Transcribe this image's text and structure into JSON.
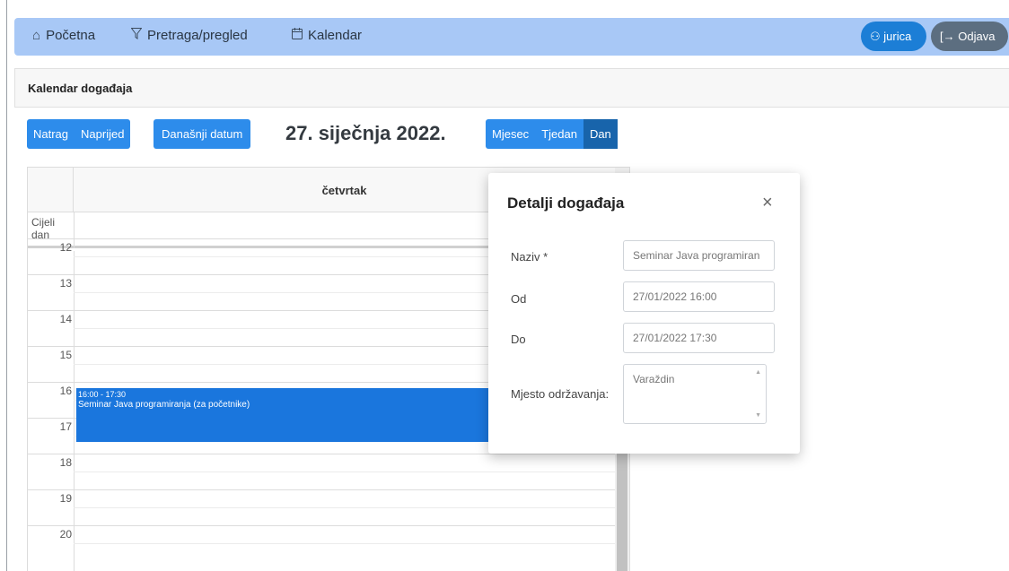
{
  "nav": {
    "home": "Početna",
    "search": "Pretraga/pregled",
    "calendar": "Kalendar",
    "user": "jurica",
    "logout": "Odjava"
  },
  "card": {
    "title": "Kalendar događaja"
  },
  "toolbar": {
    "prev": "Natrag",
    "next": "Naprijed",
    "today": "Današnji datum",
    "date_title": "27. siječnja 2022.",
    "views": [
      "Mjesec",
      "Tjedan",
      "Dan"
    ],
    "active_view": "Dan"
  },
  "calendar": {
    "day_header": "četvrtak",
    "all_day_label": "Cijeli dan",
    "hours": [
      "12",
      "13",
      "14",
      "15",
      "16",
      "17",
      "18",
      "19",
      "20"
    ],
    "event": {
      "time": "16:00 - 17:30",
      "title": "Seminar Java programiranja (za početnike)"
    }
  },
  "modal": {
    "title": "Detalji događaja",
    "close": "×",
    "fields": {
      "name_label": "Naziv *",
      "name_value": "Seminar Java programiran",
      "from_label": "Od",
      "from_value": "27/01/2022 16:00",
      "to_label": "Do",
      "to_value": "27/01/2022 17:30",
      "location_label": "Mjesto održavanja:",
      "location_value": "Varaždin"
    }
  },
  "icons": {
    "home": "home-icon",
    "filter": "filter-icon",
    "calendar": "calendar-icon",
    "user": "user-check-icon",
    "logout": "logout-icon"
  },
  "colors": {
    "navbar": "#a8c8f6",
    "primary": "#2d8ceb",
    "active": "#1864ab",
    "event": "#1a76dd",
    "logout": "#5c6e80"
  }
}
